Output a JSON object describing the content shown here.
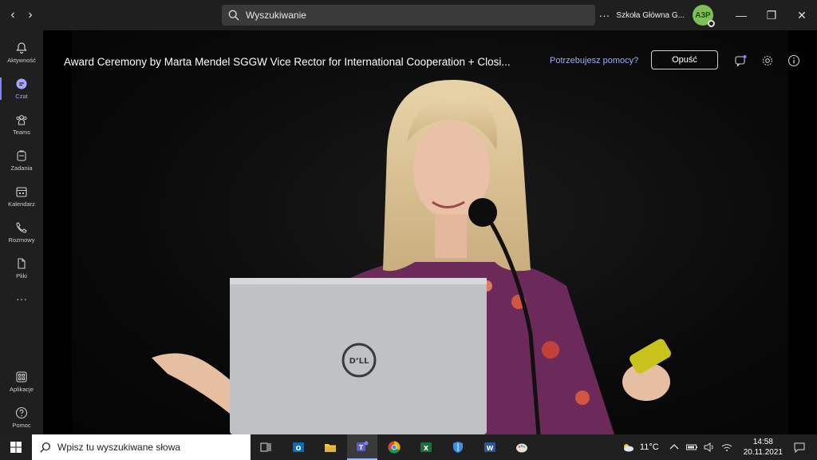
{
  "search": {
    "placeholder": "Wyszukiwanie"
  },
  "header": {
    "org_name": "Szkoła Główna G...",
    "avatar_initials": "A3P"
  },
  "rail": {
    "items": [
      {
        "label": "Aktywność",
        "icon": "bell-icon"
      },
      {
        "label": "Czat",
        "icon": "chat-icon"
      },
      {
        "label": "Teams",
        "icon": "teams-icon"
      },
      {
        "label": "Zadania",
        "icon": "tasks-icon"
      },
      {
        "label": "Kalendarz",
        "icon": "calendar-icon"
      },
      {
        "label": "Rozmowy",
        "icon": "phone-icon"
      },
      {
        "label": "Pliki",
        "icon": "file-icon"
      }
    ],
    "apps_label": "Aplikacje",
    "help_label": "Pomoc"
  },
  "meeting": {
    "title": "Award Ceremony by Marta Mendel SGGW Vice Rector for International Cooperation + Closi...",
    "help_link": "Potrzebujesz pomocy?",
    "leave_button": "Opuść"
  },
  "taskbar": {
    "search_placeholder": "Wpisz tu wyszukiwane słowa",
    "temperature": "11°C",
    "time": "14:58",
    "date": "20.11.2021"
  },
  "colors": {
    "accent": "#7f85f5",
    "link": "#a6a7ff",
    "background": "#1f1f1f"
  }
}
